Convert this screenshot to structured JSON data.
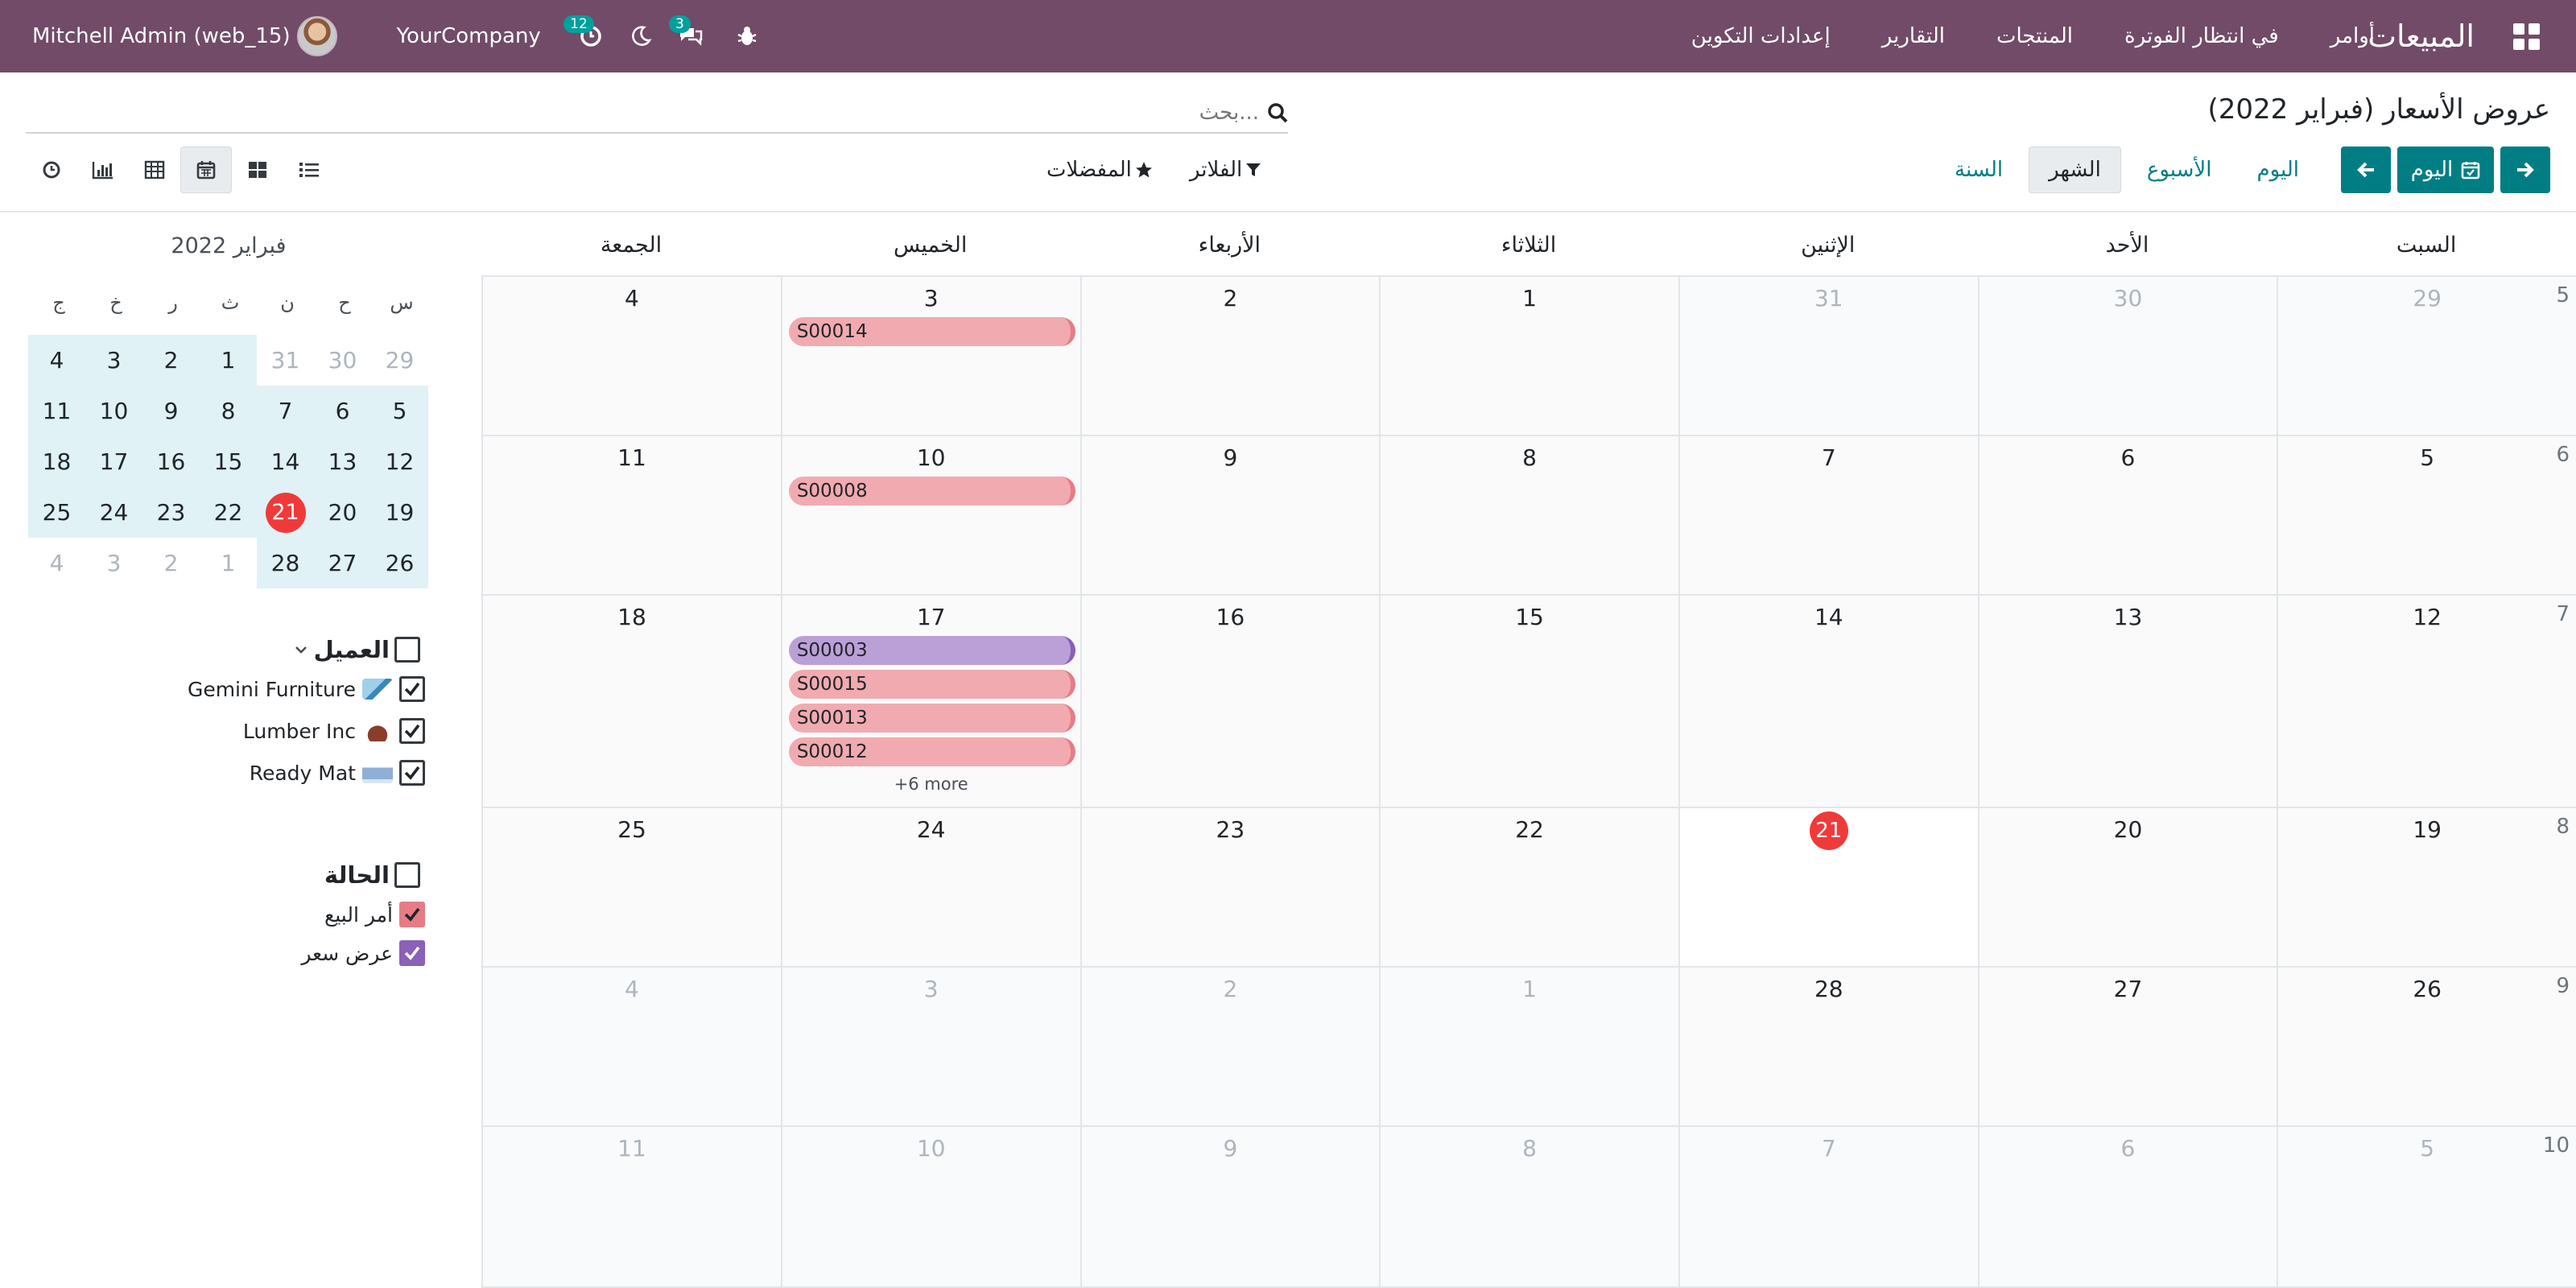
{
  "navbar": {
    "app_name": "المبيعات",
    "menu": [
      "أوامر",
      "في انتظار الفوترة",
      "المنتجات",
      "التقارير",
      "إعدادات التكوين"
    ],
    "user_name": "Mitchell Admin (web_15)",
    "company": "YourCompany",
    "activity_count": "12",
    "messages_count": "3",
    "brand_color": "#714b67"
  },
  "control_panel": {
    "title": "عروض الأسعار (فبراير 2022)",
    "search_placeholder": "بحث...",
    "today_label": "اليوم",
    "scales": [
      "اليوم",
      "الأسبوع",
      "الشهر",
      "السنة"
    ],
    "active_scale": "الشهر",
    "filters_label": "الفلاتر",
    "favorites_label": "المفضلات",
    "accent_color": "#017e84"
  },
  "calendar": {
    "weekdays": [
      "السبت",
      "الأحد",
      "الإثنين",
      "الثلاثاء",
      "الأربعاء",
      "الخميس",
      "الجمعة"
    ],
    "weeks": [
      {
        "week": "5",
        "days": [
          "29",
          "30",
          "31",
          "1",
          "2",
          "3",
          "4"
        ]
      },
      {
        "week": "6",
        "days": [
          "5",
          "6",
          "7",
          "8",
          "9",
          "10",
          "11"
        ]
      },
      {
        "week": "7",
        "days": [
          "12",
          "13",
          "14",
          "15",
          "16",
          "17",
          "18"
        ]
      },
      {
        "week": "8",
        "days": [
          "19",
          "20",
          "21",
          "22",
          "23",
          "24",
          "25"
        ]
      },
      {
        "week": "9",
        "days": [
          "26",
          "27",
          "28",
          "1",
          "2",
          "3",
          "4"
        ]
      },
      {
        "week": "10",
        "days": [
          "5",
          "6",
          "7",
          "8",
          "9",
          "10",
          "11"
        ]
      }
    ],
    "events": {
      "w0": [
        {
          "name": "S00014",
          "state": "sale"
        }
      ],
      "w1": [
        {
          "name": "S00008",
          "state": "sale"
        }
      ],
      "w2": [
        {
          "name": "S00003",
          "state": "quote"
        },
        {
          "name": "S00015",
          "state": "sale"
        },
        {
          "name": "S00013",
          "state": "sale"
        },
        {
          "name": "S00012",
          "state": "sale"
        }
      ]
    },
    "more_label": "+6 more",
    "today_day": "21"
  },
  "sidebar": {
    "mini_title": "فبراير 2022",
    "mini_headers": [
      "س",
      "ح",
      "ن",
      "ث",
      "ر",
      "خ",
      "ج"
    ],
    "mini_weeks": [
      [
        "29",
        "30",
        "31",
        "1",
        "2",
        "3",
        "4"
      ],
      [
        "5",
        "6",
        "7",
        "8",
        "9",
        "10",
        "11"
      ],
      [
        "12",
        "13",
        "14",
        "15",
        "16",
        "17",
        "18"
      ],
      [
        "19",
        "20",
        "21",
        "22",
        "23",
        "24",
        "25"
      ],
      [
        "26",
        "27",
        "28",
        "1",
        "2",
        "3",
        "4"
      ]
    ],
    "customer_filter_title": "العميل",
    "customers": [
      "Gemini Furniture",
      "Lumber Inc",
      "Ready Mat"
    ],
    "status_filter_title": "الحالة",
    "statuses": [
      {
        "label": "أمر البيع",
        "color": "#e67c86"
      },
      {
        "label": "عرض سعر",
        "color": "#8a60b8"
      }
    ]
  }
}
